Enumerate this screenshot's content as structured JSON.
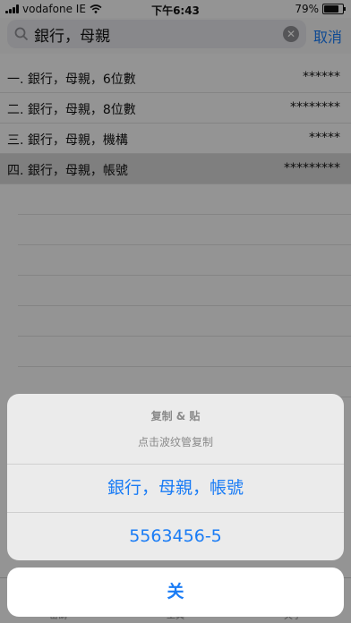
{
  "status": {
    "carrier": "vodafone IE",
    "time": "下午6:43",
    "battery": "79%",
    "battery_level": 0.79
  },
  "search": {
    "query": "銀行，母親",
    "cancel_label": "取消"
  },
  "list": [
    {
      "label": "一. 銀行，母親，6位數",
      "mask": "******",
      "selected": false
    },
    {
      "label": "二. 銀行，母親，8位數",
      "mask": "********",
      "selected": false
    },
    {
      "label": "三. 銀行，母親，機構",
      "mask": "*****",
      "selected": false
    },
    {
      "label": "四. 銀行，母親，帳號",
      "mask": "*********",
      "selected": true
    }
  ],
  "tabs": [
    "密碼",
    "工具",
    "关于"
  ],
  "sheet": {
    "title": "复制 & 贴",
    "message": "点击波纹管复制",
    "option1": "銀行，母親，帳號",
    "option2": "5563456-5",
    "cancel": "关"
  },
  "colors": {
    "accent": "#1a7cf5",
    "selected_row": "#d4d4d4"
  }
}
